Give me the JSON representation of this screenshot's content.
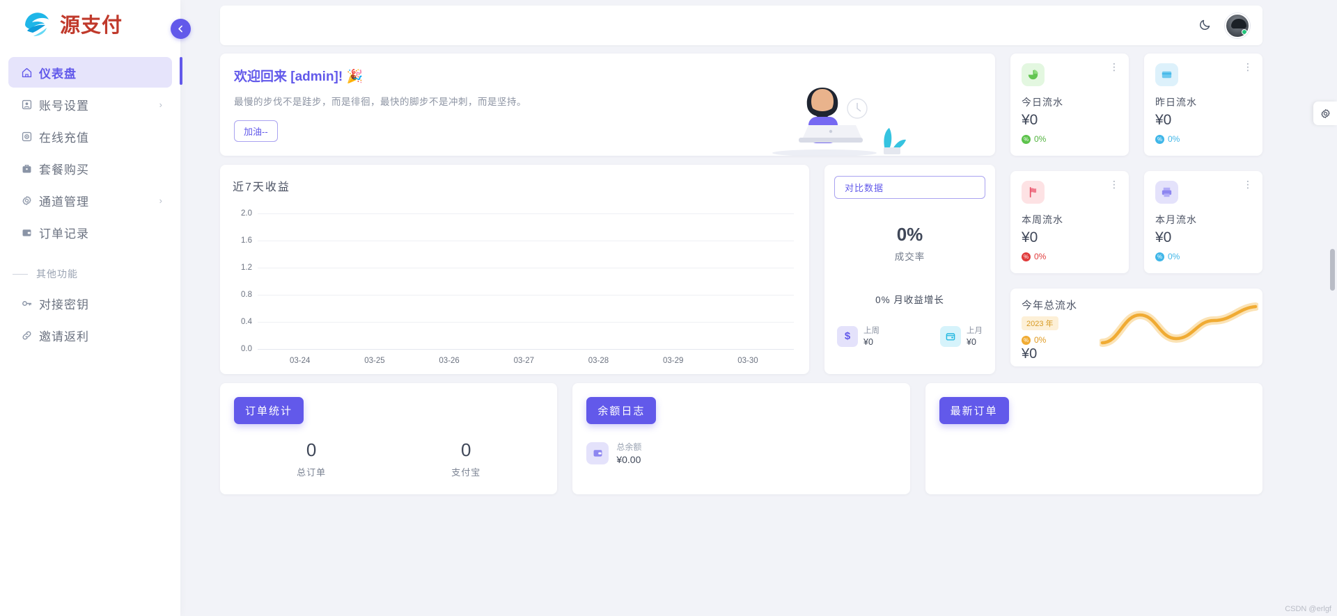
{
  "brand": {
    "name": "源支付",
    "logo_icon": "wave-globe-logo"
  },
  "sidebar": {
    "collapse_icon": "chevron-left-icon",
    "items": [
      {
        "label": "仪表盘",
        "icon": "home-icon",
        "active": true,
        "has_arrow": false
      },
      {
        "label": "账号设置",
        "icon": "id-card-icon",
        "active": false,
        "has_arrow": true
      },
      {
        "label": "在线充值",
        "icon": "camera-box-icon",
        "active": false,
        "has_arrow": false
      },
      {
        "label": "套餐购买",
        "icon": "briefcase-icon",
        "active": false,
        "has_arrow": false
      },
      {
        "label": "通道管理",
        "icon": "gear-icon",
        "active": false,
        "has_arrow": true
      },
      {
        "label": "订单记录",
        "icon": "wallet-icon",
        "active": false,
        "has_arrow": false
      }
    ],
    "section_label": "其他功能",
    "other_items": [
      {
        "label": "对接密钥",
        "icon": "key-icon"
      },
      {
        "label": "邀请返利",
        "icon": "link-icon"
      }
    ]
  },
  "topbar": {
    "theme_toggle_icon": "moon-icon",
    "avatar_icon": "user-avatar",
    "online_status": "online"
  },
  "welcome": {
    "title": "欢迎回来 [admin]! 🎉",
    "quote": "最慢的步伐不是跬步，而是徘徊，最快的脚步不是冲刺，而是坚持。",
    "button_label": "加油--",
    "illustration_icon": "man-at-desk-illustration"
  },
  "chart_data": {
    "type": "line",
    "title": "近7天收益",
    "categories": [
      "03-24",
      "03-25",
      "03-26",
      "03-27",
      "03-28",
      "03-29",
      "03-30"
    ],
    "values": [
      0,
      0,
      0,
      0,
      0,
      0,
      0
    ],
    "yticks": [
      "2.0",
      "1.6",
      "1.2",
      "0.8",
      "0.4",
      "0.0"
    ],
    "ylim": [
      0,
      2.0
    ],
    "xlabel": "",
    "ylabel": "",
    "grid": true,
    "legend": "none"
  },
  "rate_panel": {
    "compare_button": "对比数据",
    "rate_value": "0%",
    "rate_label": "成交率",
    "growth_text": "0% 月收益增长",
    "minis": [
      {
        "icon": "dollar-icon",
        "label": "上周",
        "value": "¥0",
        "color": "#6259ea",
        "bg": "#e4e2fb"
      },
      {
        "icon": "calendar-wallet-icon",
        "label": "上月",
        "value": "¥0",
        "color": "#21b8e0",
        "bg": "#d6f3fb"
      }
    ]
  },
  "stats": [
    {
      "label": "今日流水",
      "value": "¥0",
      "delta": "0%",
      "icon": "pie-chart-icon",
      "icon_bg": "#e3f7e0",
      "icon_color": "#63c552",
      "delta_color": "#52b33f",
      "badge_bg": "#5cc34b",
      "menu_icon": "more-vertical-icon"
    },
    {
      "label": "昨日流水",
      "value": "¥0",
      "delta": "0%",
      "icon": "card-icon",
      "icon_bg": "#ddf1fb",
      "icon_color": "#3fb6e8",
      "delta_color": "#3fb6e8",
      "badge_bg": "#3fb6e8",
      "menu_icon": "more-vertical-icon"
    },
    {
      "label": "本周流水",
      "value": "¥0",
      "delta": "0%",
      "icon": "flag-icon",
      "icon_bg": "#fde2e4",
      "icon_color": "#e8546a",
      "delta_color": "#e03b3b",
      "badge_bg": "#e03b3b",
      "menu_icon": "more-vertical-icon"
    },
    {
      "label": "本月流水",
      "value": "¥0",
      "delta": "0%",
      "icon": "printer-icon",
      "icon_bg": "#e4e2fb",
      "icon_color": "#8d86f0",
      "delta_color": "#3fb6e8",
      "badge_bg": "#3fb6e8",
      "menu_icon": "more-vertical-icon"
    }
  ],
  "year_card": {
    "title": "今年总流水",
    "tag": "2023 年",
    "delta": "0%",
    "value": "¥0",
    "sparkline_icon": "wave-sparkline",
    "sparkline_color": "#f0ab33"
  },
  "bottom": {
    "orders": {
      "title": "订单统计",
      "metrics": [
        {
          "value": "0",
          "label": "总订单"
        },
        {
          "value": "0",
          "label": "支付宝"
        }
      ]
    },
    "balance": {
      "title": "余额日志",
      "icon": "wallet-icon",
      "label": "总余额",
      "value": "¥0.00"
    },
    "latest": {
      "title": "最新订单"
    }
  },
  "right_edge": {
    "settings_icon": "gear-icon",
    "scrollbar": "vertical-scrollbar"
  },
  "watermark": "CSDN @erlgf",
  "colors": {
    "accent": "#6259ea",
    "bg": "#f2f3f8",
    "card": "#ffffff",
    "text": "#3f4758",
    "muted": "#8d94a3"
  }
}
